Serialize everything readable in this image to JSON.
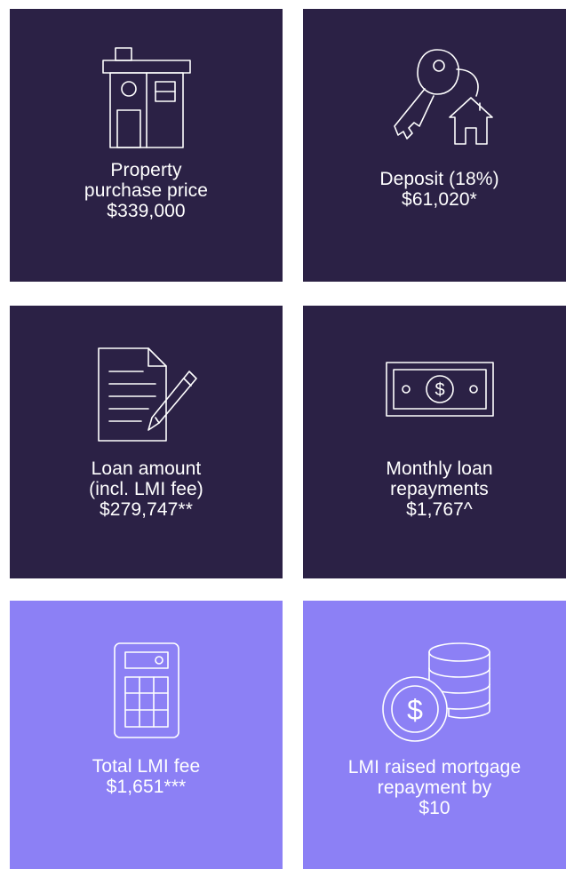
{
  "tiles": [
    {
      "icon": "house-icon",
      "lines": [
        "Property",
        "purchase price",
        "$339,000"
      ],
      "theme": "#2b2145"
    },
    {
      "icon": "house-key-icon",
      "lines": [
        "Deposit (18%)",
        "$61,020*"
      ],
      "theme": "#2b2145"
    },
    {
      "icon": "document-pen-icon",
      "lines": [
        "Loan amount",
        "(incl. LMI fee)",
        "$279,747**"
      ],
      "theme": "#2b2145"
    },
    {
      "icon": "banknote-icon",
      "lines": [
        "Monthly loan",
        "repayments",
        "$1,767^"
      ],
      "theme": "#2b2145"
    },
    {
      "icon": "calculator-icon",
      "lines": [
        "Total LMI fee",
        "$1,651***"
      ],
      "theme": "#8c80f5"
    },
    {
      "icon": "coin-stack-icon",
      "lines": [
        "LMI raised mortgage",
        "repayment by",
        "$10"
      ],
      "theme": "#8c80f5"
    }
  ]
}
